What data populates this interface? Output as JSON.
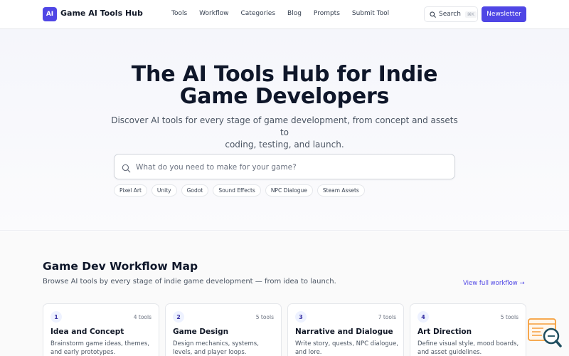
{
  "header": {
    "logo_badge": "AI",
    "logo_text": "Game AI Tools Hub",
    "nav": [
      "Tools",
      "Workflow",
      "Categories",
      "Blog",
      "Prompts",
      "Submit Tool"
    ],
    "search_label": "Search",
    "search_shortcut": "⌘K",
    "newsletter_label": "Newsletter"
  },
  "hero": {
    "title_line1": "The AI Tools Hub for Indie",
    "title_line2": "Game Developers",
    "subtitle_line1": "Discover AI tools for every stage of game development, from concept and assets to",
    "subtitle_line2": "coding, testing, and launch.",
    "search_placeholder": "What do you need to make for your game?",
    "tags": [
      "Pixel Art",
      "Unity",
      "Godot",
      "Sound Effects",
      "NPC Dialogue",
      "Steam Assets"
    ]
  },
  "workflow": {
    "title": "Game Dev Workflow Map",
    "subtitle": "Browse AI tools by every stage of indie game development — from idea to launch.",
    "view_link": "View full workflow →",
    "cards": [
      {
        "num": "1",
        "count": "4 tools",
        "title": "Idea and Concept",
        "desc": "Brainstorm game ideas, themes, and early prototypes."
      },
      {
        "num": "2",
        "count": "5 tools",
        "title": "Game Design",
        "desc": "Design mechanics, systems, levels, and player loops."
      },
      {
        "num": "3",
        "count": "7 tools",
        "title": "Narrative and Dialogue",
        "desc": "Write story, quests, NPC dialogue, and lore."
      },
      {
        "num": "4",
        "count": "5 tools",
        "title": "Art Direction",
        "desc": "Define visual style, mood boards, and asset guidelines."
      }
    ]
  },
  "colors": {
    "accent": "#4f46e5",
    "widget_orange": "#f59e3b",
    "widget_teal": "#1f4e5f"
  }
}
